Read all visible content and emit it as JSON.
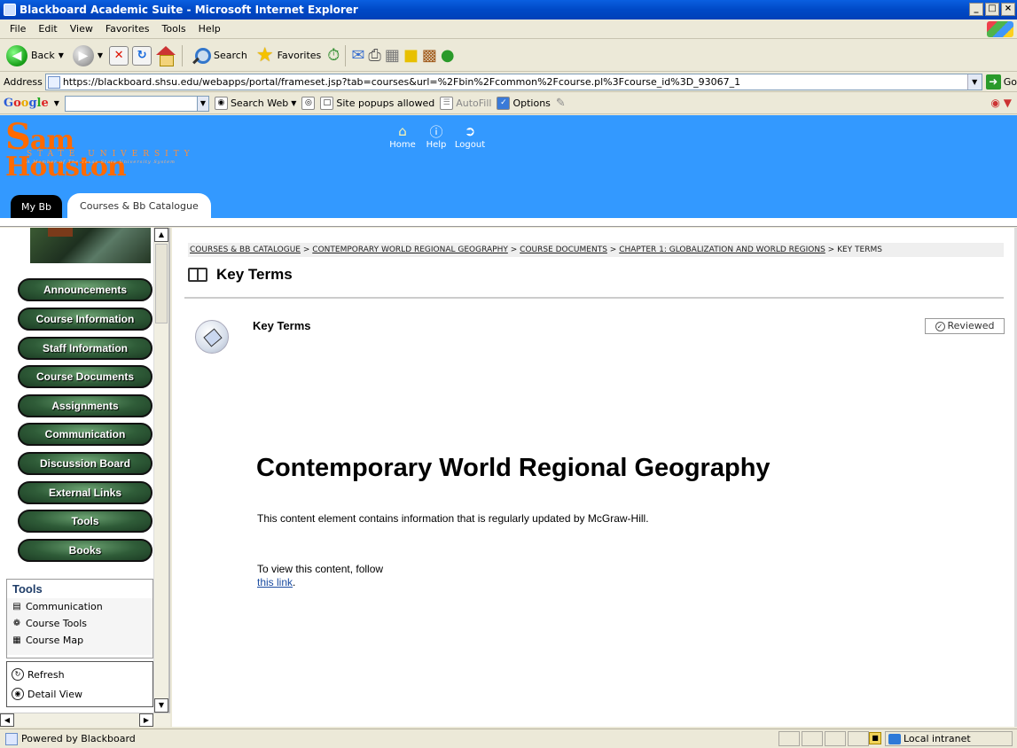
{
  "window": {
    "title": "Blackboard Academic Suite - Microsoft Internet Explorer",
    "controls": [
      "_",
      "□",
      "×"
    ]
  },
  "menu": [
    "File",
    "Edit",
    "View",
    "Favorites",
    "Tools",
    "Help"
  ],
  "toolbar": {
    "back_label": "Back",
    "search_label": "Search",
    "favorites_label": "Favorites"
  },
  "address": {
    "label": "Address",
    "url": "https://blackboard.shsu.edu/webapps/portal/frameset.jsp?tab=courses&url=%2Fbin%2Fcommon%2Fcourse.pl%3Fcourse_id%3D_93067_1",
    "go_label": "Go"
  },
  "google": {
    "search_value": "",
    "search_web_label": "Search Web",
    "popups_label": "Site popups allowed",
    "autofill_label": "AutoFill",
    "options_label": "Options"
  },
  "header": {
    "logo": {
      "name_cap": "S",
      "name_rest": "am Houston",
      "subtitle": "STATE UNIVERSITY",
      "member": "A Member of The Texas State University System"
    },
    "nav": [
      {
        "label": "Home"
      },
      {
        "label": "Help"
      },
      {
        "label": "Logout"
      }
    ],
    "tabs": [
      {
        "label": "My Bb"
      },
      {
        "label": "Courses & Bb Catalogue"
      }
    ]
  },
  "sidebar": {
    "buttons": [
      "Announcements",
      "Course Information",
      "Staff Information",
      "Course Documents",
      "Assignments",
      "Communication",
      "Discussion Board",
      "External Links",
      "Tools",
      "Books"
    ],
    "tools_box": {
      "title": "Tools",
      "items": [
        "Communication",
        "Course Tools",
        "Course Map"
      ]
    },
    "actions": [
      "Refresh",
      "Detail View"
    ]
  },
  "main": {
    "breadcrumb": {
      "links": [
        "COURSES & BB CATALOGUE",
        "CONTEMPORARY WORLD REGIONAL GEOGRAPHY",
        "COURSE DOCUMENTS",
        "CHAPTER 1: GLOBALIZATION AND WORLD REGIONS"
      ],
      "separator": ">",
      "current": "KEY TERMS"
    },
    "page_title": "Key Terms",
    "item_heading": "Key Terms",
    "reviewed_label": "Reviewed",
    "content_heading": "Contemporary World Regional Geography",
    "content_paragraph": "This content element contains information that is regularly updated by McGraw-Hill.",
    "follow_text": "To view this content, follow",
    "follow_link": "this link",
    "follow_end": "."
  },
  "status": {
    "text": "Powered by Blackboard",
    "zone": "Local intranet"
  }
}
